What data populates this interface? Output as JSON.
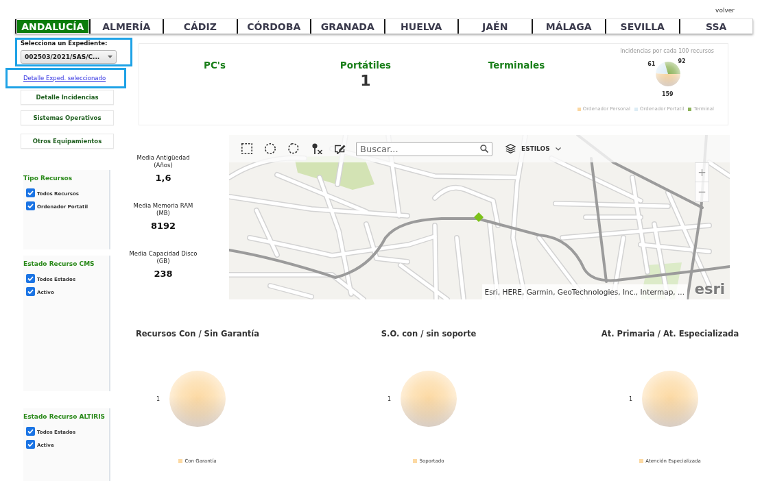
{
  "header": {
    "back_link": "volver"
  },
  "regions": [
    {
      "label": "ANDALUCÍA",
      "selected": true
    },
    {
      "label": "ALMERÍA",
      "selected": false
    },
    {
      "label": "CÁDIZ",
      "selected": false
    },
    {
      "label": "CÓRDOBA",
      "selected": false
    },
    {
      "label": "GRANADA",
      "selected": false
    },
    {
      "label": "HUELVA",
      "selected": false
    },
    {
      "label": "JAÉN",
      "selected": false
    },
    {
      "label": "MÁLAGA",
      "selected": false
    },
    {
      "label": "SEVILLA",
      "selected": false
    },
    {
      "label": "SSA",
      "selected": false
    }
  ],
  "sidebar": {
    "expediente": {
      "label": "Selecciona un Expediente:",
      "value": "002503/2021/SAS/C..."
    },
    "detail_link": "Detalle Exped. seleccionado",
    "buttons": [
      "Detalle Incidencias",
      "Sistemas Operativos",
      "Otros Equipamientos"
    ],
    "filters": [
      {
        "title": "Tipo Recursos",
        "options": [
          {
            "label": "Todos Recursos",
            "checked": true
          },
          {
            "label": "Ordenador Portatil",
            "checked": true
          }
        ]
      },
      {
        "title": "Estado Recurso CMS",
        "options": [
          {
            "label": "Todos Estados",
            "checked": true
          },
          {
            "label": "Activo",
            "checked": true
          }
        ]
      },
      {
        "title": "Estado Recurso ALTIRIS",
        "options": [
          {
            "label": "Todos Estados",
            "checked": true
          },
          {
            "label": "Active",
            "checked": true
          }
        ]
      }
    ]
  },
  "summary": {
    "counters": [
      {
        "label": "PC's"
      },
      {
        "label": "Portátiles",
        "value": "1"
      },
      {
        "label": "Terminales"
      }
    ],
    "chart_data": {
      "type": "pie",
      "title": "Incidencias por cada 100 recursos",
      "categories": [
        "Ordenador Personal",
        "Ordenador Portatil",
        "Terminal"
      ],
      "values": [
        159,
        61,
        92
      ],
      "colors": [
        "#fbd7a1",
        "#dcecf5",
        "#8db35a"
      ],
      "data_labels": true,
      "legend": "bottom"
    }
  },
  "stats": [
    {
      "label": "Media Antigüedad",
      "unit": "(Años)",
      "value": "1,6"
    },
    {
      "label": "Media Memoria RAM",
      "unit": "(MB)",
      "value": "8192"
    },
    {
      "label": "Media Capacidad Disco",
      "unit": "(GB)",
      "value": "238"
    }
  ],
  "map": {
    "search": {
      "placeholder": "Buscar..."
    },
    "styles_button": "ESTILOS",
    "zoom": [
      "+",
      "−"
    ],
    "attribution": "Esri, HERE, Garmin, GeoTechnologies, Inc., Intermap, ...",
    "logo": "esri"
  },
  "charts": [
    {
      "chart_data": {
        "type": "pie",
        "title": "Recursos Con / Sin Garantía",
        "categories": [
          "Con Garantía"
        ],
        "values": [
          1
        ],
        "colors": [
          "#fcd9a3"
        ],
        "data_labels": true,
        "legend": "bottom"
      }
    },
    {
      "chart_data": {
        "type": "pie",
        "title": "S.O. con / sin soporte",
        "categories": [
          "Soportado"
        ],
        "values": [
          1
        ],
        "colors": [
          "#fcd9a3"
        ],
        "data_labels": true,
        "legend": "bottom"
      }
    },
    {
      "chart_data": {
        "type": "pie",
        "title": "At. Primaria / At. Especializada",
        "categories": [
          "Atención Especializada"
        ],
        "values": [
          1
        ],
        "colors": [
          "#fcd9a3"
        ],
        "data_labels": true,
        "legend": "bottom"
      }
    }
  ]
}
